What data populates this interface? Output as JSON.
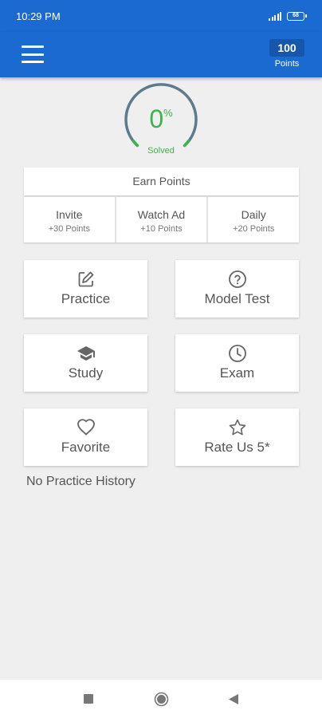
{
  "status_bar": {
    "time": "10:29 PM",
    "battery": "68"
  },
  "app_bar": {
    "points_value": "100",
    "points_label": "Points"
  },
  "progress": {
    "value": "0",
    "unit": "%",
    "label": "Solved",
    "fraction": 0
  },
  "earn": {
    "header": "Earn Points",
    "items": [
      {
        "label": "Invite",
        "sub": "+30 Points"
      },
      {
        "label": "Watch Ad",
        "sub": "+10 Points"
      },
      {
        "label": "Daily",
        "sub": "+20 Points"
      }
    ]
  },
  "menu": {
    "practice": "Practice",
    "model_test": "Model Test",
    "study": "Study",
    "exam": "Exam",
    "favorite": "Favorite",
    "rate_us": "Rate Us 5*"
  },
  "icons": {
    "practice": "edit-icon",
    "model_test": "help-circle-icon",
    "study": "graduation-cap-icon",
    "exam": "clock-icon",
    "favorite": "heart-icon",
    "rate_us": "star-icon"
  },
  "history": {
    "empty_text": "No Practice History"
  },
  "colors": {
    "primary": "#1a6ad1",
    "primary_dark": "#1656ab",
    "success": "#3bb54a",
    "background": "#efefef"
  }
}
